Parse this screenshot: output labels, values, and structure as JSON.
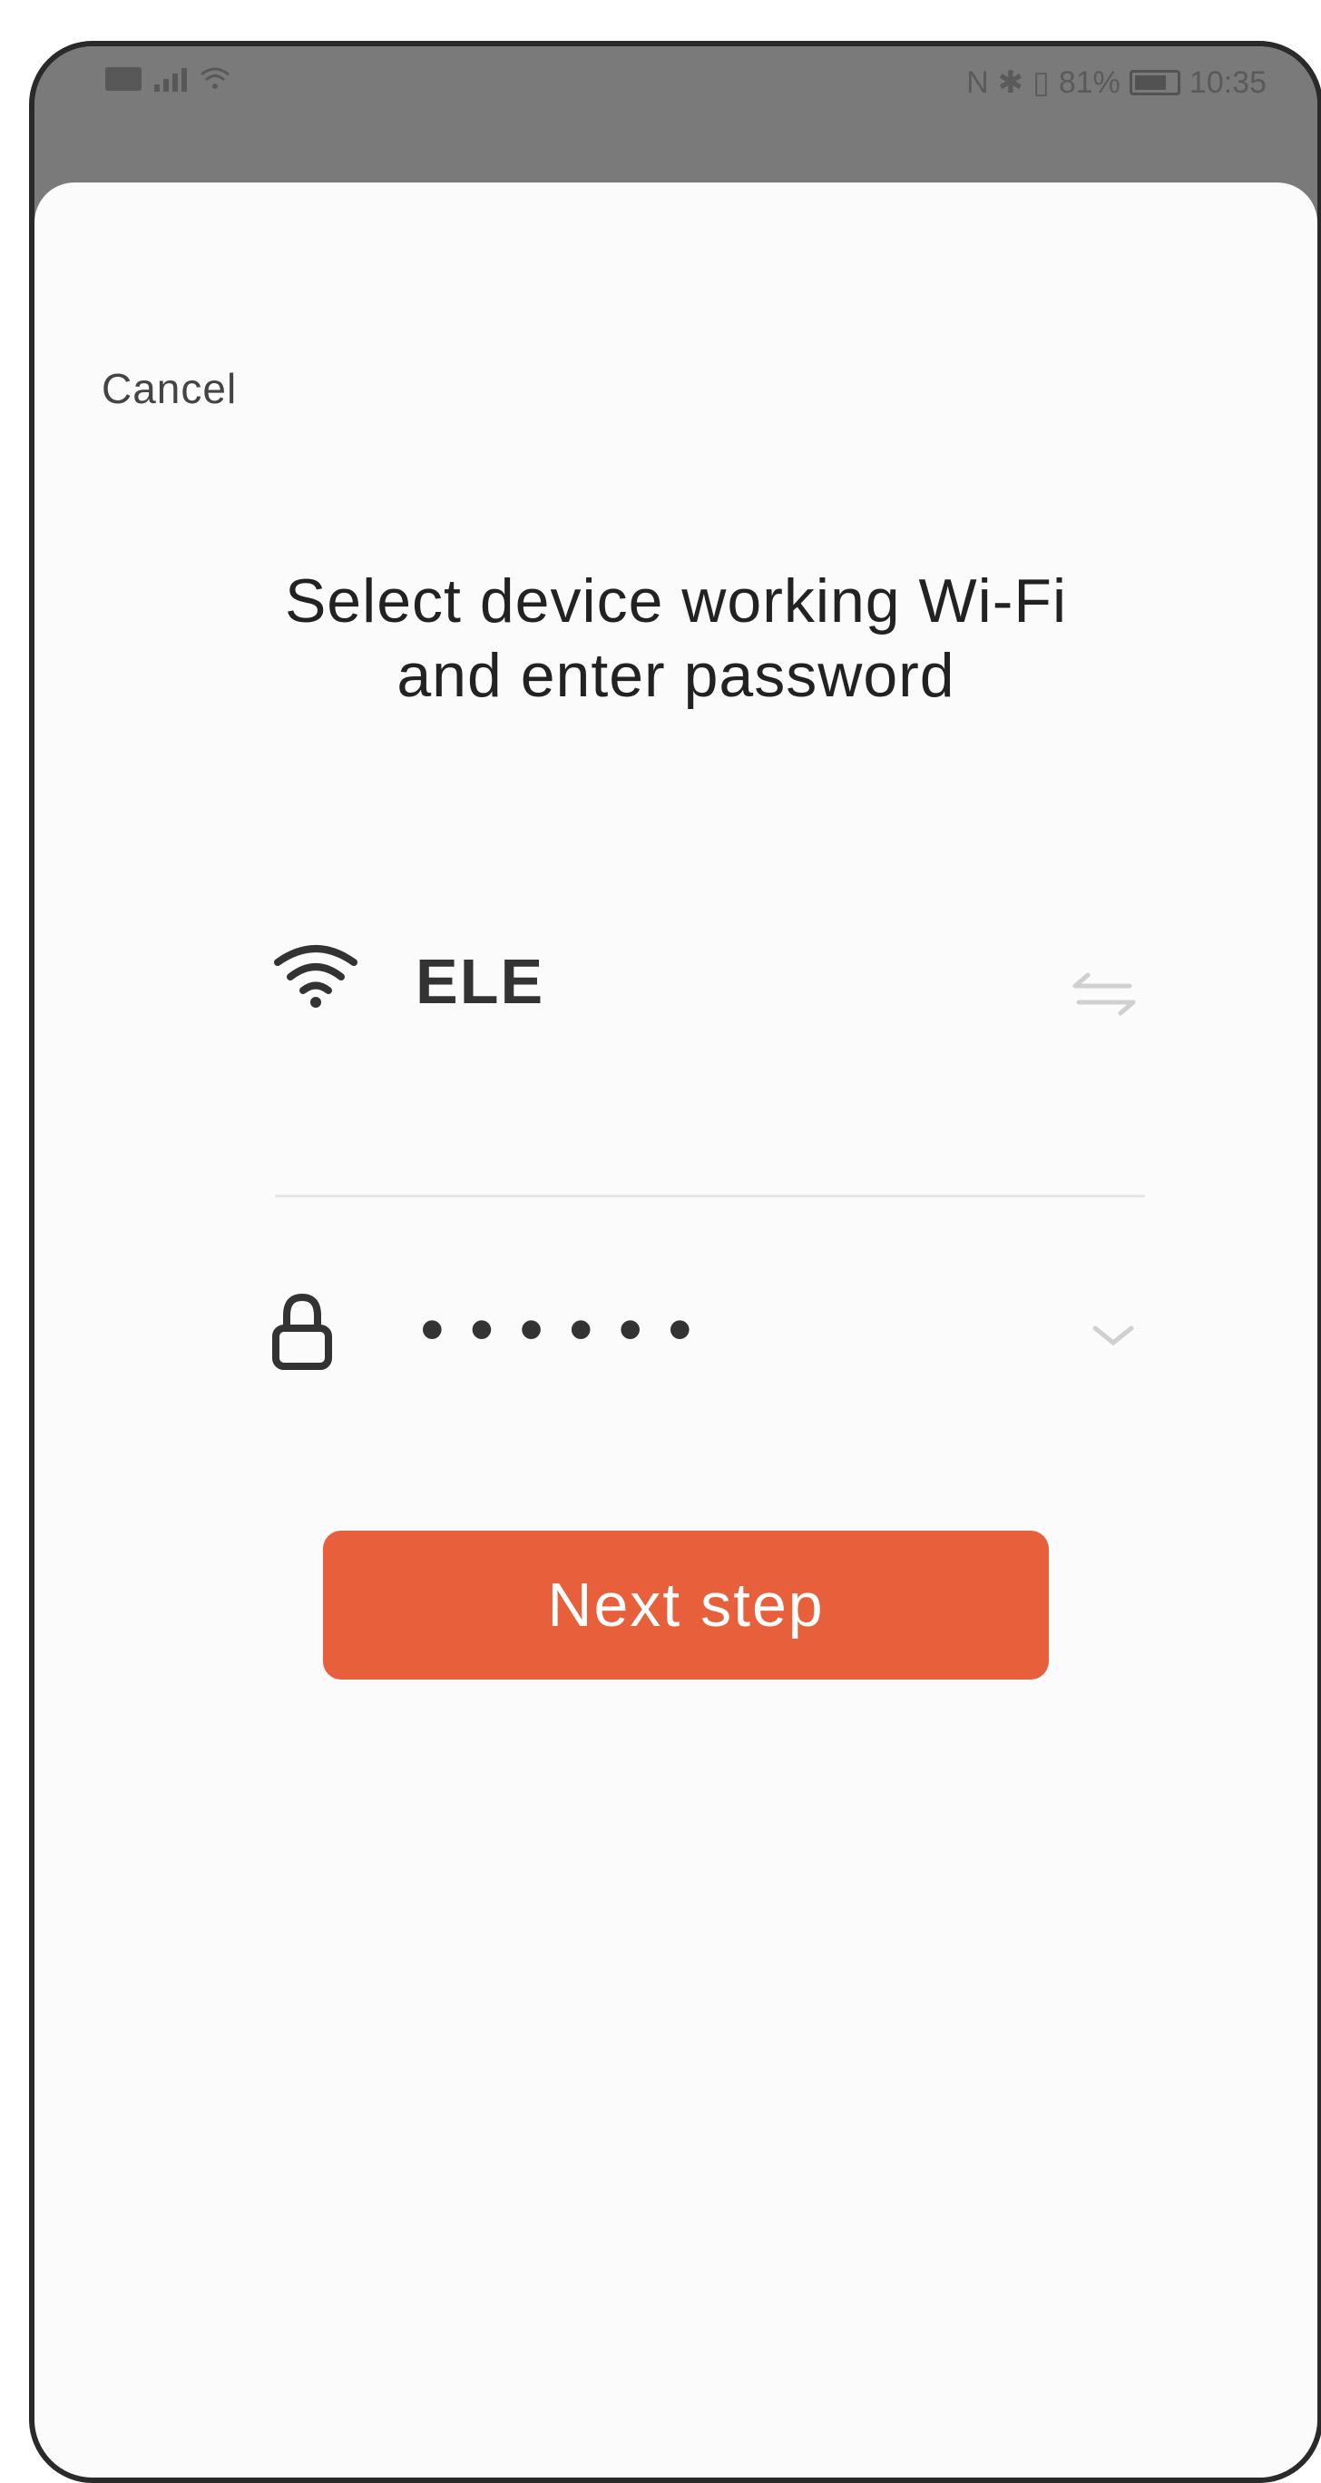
{
  "status_bar": {
    "time": "10:35",
    "battery": "81%",
    "battery_level": 0.81
  },
  "nav": {
    "cancel_label": "Cancel"
  },
  "main": {
    "title_line1": "Select device working Wi-Fi",
    "title_line2": "and enter password",
    "wifi_name": "ELE",
    "password_mask": "••••••",
    "next_label": "Next step"
  },
  "colors": {
    "accent": "#e85f3b",
    "status_bar_bg": "#7a7a7a",
    "sheet_bg": "#fbfbfb"
  },
  "icons": [
    "wifi-icon",
    "switch-network-icon",
    "lock-icon",
    "chevron-down-icon",
    "sim-icon",
    "signal-icon",
    "battery-icon"
  ]
}
